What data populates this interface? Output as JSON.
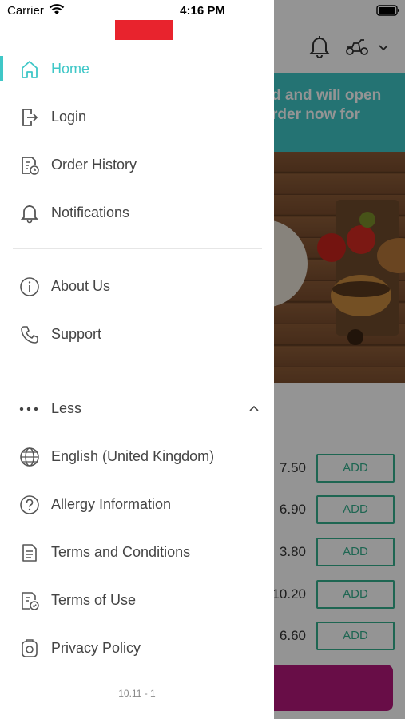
{
  "status_bar": {
    "carrier": "Carrier",
    "time": "4:16 PM"
  },
  "background": {
    "banner_text_line1": "d and will open",
    "banner_text_line2": "rder now for",
    "items": [
      {
        "price": "7.50",
        "action": "ADD"
      },
      {
        "price": "6.90",
        "action": "ADD"
      },
      {
        "price": "3.80",
        "action": "ADD"
      },
      {
        "price": "10.20",
        "action": "ADD"
      },
      {
        "price": "6.60",
        "action": "ADD"
      }
    ]
  },
  "drawer": {
    "primary": [
      {
        "label": "Home",
        "icon": "home-icon",
        "active": true
      },
      {
        "label": "Login",
        "icon": "login-icon"
      },
      {
        "label": "Order History",
        "icon": "order-history-icon"
      },
      {
        "label": "Notifications",
        "icon": "bell-icon"
      }
    ],
    "secondary": [
      {
        "label": "About Us",
        "icon": "info-icon"
      },
      {
        "label": "Support",
        "icon": "phone-icon"
      }
    ],
    "less_label": "Less",
    "more": [
      {
        "label": "English (United Kingdom)",
        "icon": "globe-icon"
      },
      {
        "label": "Allergy Information",
        "icon": "question-icon"
      },
      {
        "label": "Terms and Conditions",
        "icon": "document-icon"
      },
      {
        "label": "Terms of Use",
        "icon": "document-check-icon"
      },
      {
        "label": "Privacy Policy",
        "icon": "privacy-icon"
      }
    ],
    "version": "10.11 - 1"
  },
  "colors": {
    "accent": "#3fc7c7",
    "add_button": "#35b08e",
    "checkout": "#b4177a",
    "logo": "#e8232d"
  }
}
